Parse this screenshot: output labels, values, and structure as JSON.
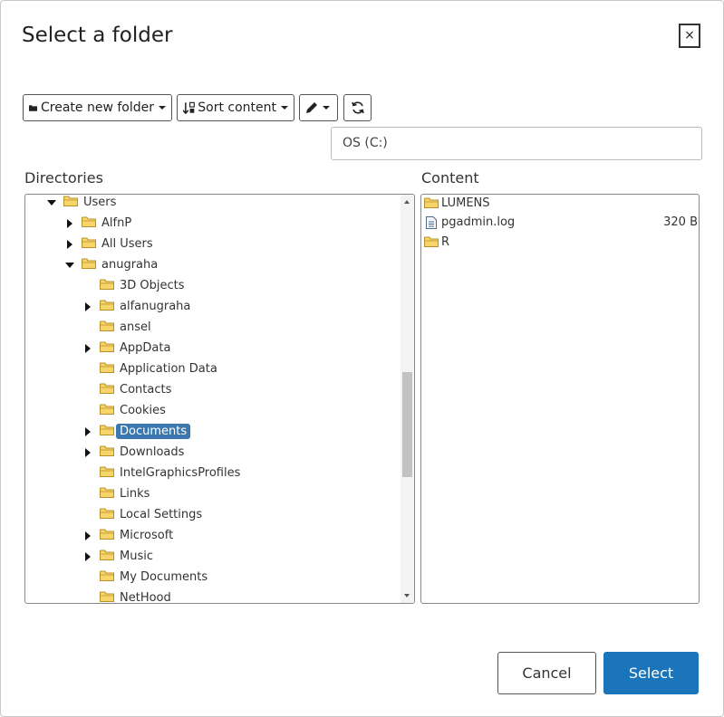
{
  "dialog": {
    "title": "Select a folder",
    "close_label": "×"
  },
  "toolbar": {
    "create_folder_label": "Create new folder",
    "sort_label": "Sort content"
  },
  "path": {
    "value": "OS (C:)"
  },
  "directories": {
    "heading": "Directories",
    "items": [
      {
        "label": "Users",
        "expander": "expanded",
        "selected": false
      },
      {
        "label": "AlfnP",
        "expander": "collapsed",
        "selected": false
      },
      {
        "label": "All Users",
        "expander": "collapsed",
        "selected": false
      },
      {
        "label": "anugraha",
        "expander": "expanded",
        "selected": false
      },
      {
        "label": "3D Objects",
        "expander": "none",
        "selected": false
      },
      {
        "label": "alfanugraha",
        "expander": "collapsed",
        "selected": false
      },
      {
        "label": "ansel",
        "expander": "none",
        "selected": false
      },
      {
        "label": "AppData",
        "expander": "collapsed",
        "selected": false
      },
      {
        "label": "Application Data",
        "expander": "none",
        "selected": false
      },
      {
        "label": "Contacts",
        "expander": "none",
        "selected": false
      },
      {
        "label": "Cookies",
        "expander": "none",
        "selected": false
      },
      {
        "label": "Documents",
        "expander": "collapsed",
        "selected": true
      },
      {
        "label": "Downloads",
        "expander": "collapsed",
        "selected": false
      },
      {
        "label": "IntelGraphicsProfiles",
        "expander": "none",
        "selected": false
      },
      {
        "label": "Links",
        "expander": "none",
        "selected": false
      },
      {
        "label": "Local Settings",
        "expander": "none",
        "selected": false
      },
      {
        "label": "Microsoft",
        "expander": "collapsed",
        "selected": false
      },
      {
        "label": "Music",
        "expander": "collapsed",
        "selected": false
      },
      {
        "label": "My Documents",
        "expander": "none",
        "selected": false
      },
      {
        "label": "NetHood",
        "expander": "none",
        "selected": false
      }
    ]
  },
  "content": {
    "heading": "Content",
    "items": [
      {
        "name": "LUMENS",
        "type": "folder",
        "size": ""
      },
      {
        "name": "pgadmin.log",
        "type": "file",
        "size": "320 B"
      },
      {
        "name": "R",
        "type": "folder",
        "size": ""
      }
    ]
  },
  "footer": {
    "cancel_label": "Cancel",
    "select_label": "Select"
  },
  "colors": {
    "accent": "#1b75bb",
    "selection": "#3b78b0",
    "folder": "#f0c040"
  }
}
